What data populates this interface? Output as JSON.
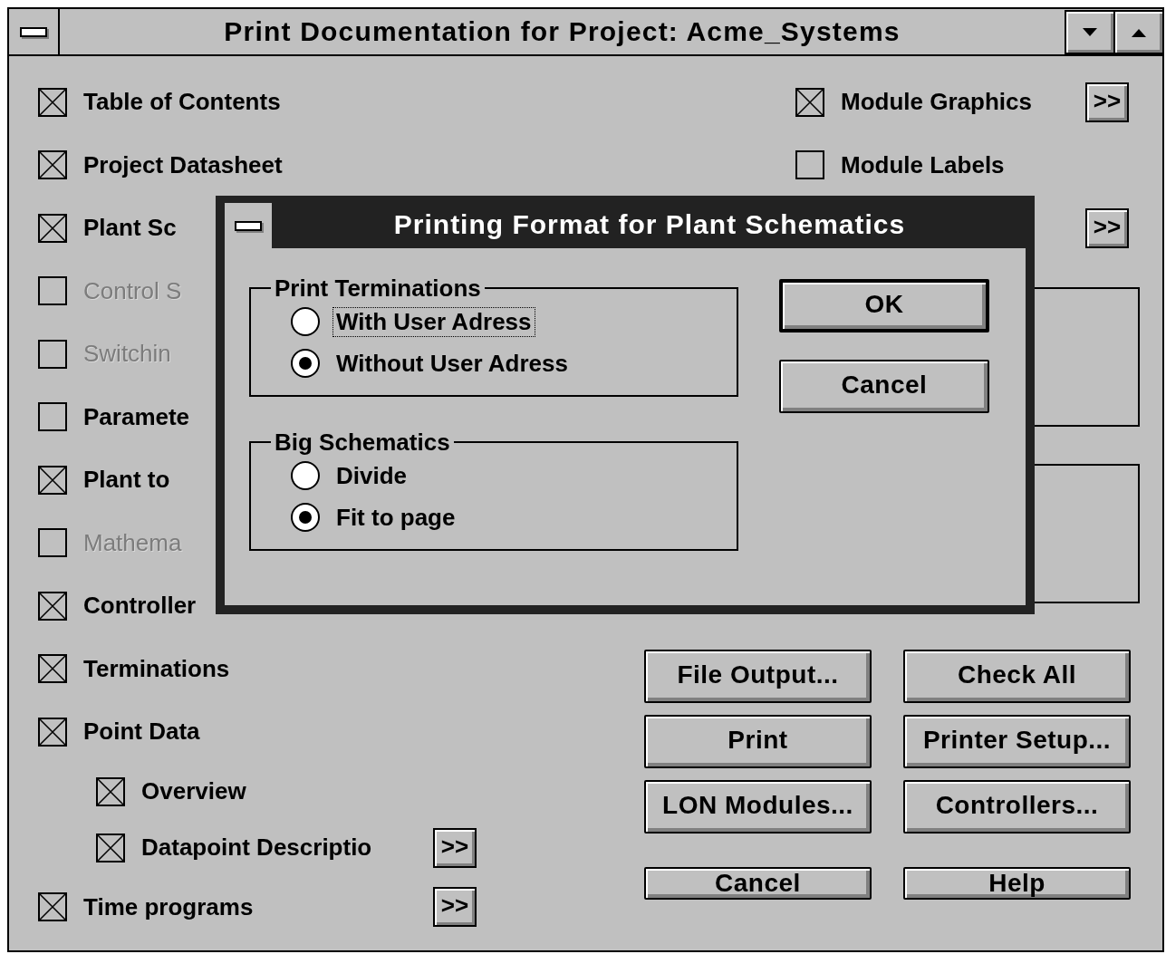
{
  "window": {
    "title": "Print Documentation for Project: Acme_Systems"
  },
  "left_options": [
    {
      "label": "Table of Contents",
      "checked": true,
      "disabled": false
    },
    {
      "label": "Project Datasheet",
      "checked": true,
      "disabled": false
    },
    {
      "label": "Plant Sc",
      "checked": true,
      "disabled": false
    },
    {
      "label": "Control S",
      "checked": false,
      "disabled": true
    },
    {
      "label": "Switchin",
      "checked": false,
      "disabled": true
    },
    {
      "label": "Paramete",
      "checked": false,
      "disabled": false
    },
    {
      "label": "Plant to",
      "checked": true,
      "disabled": false
    },
    {
      "label": "Mathema",
      "checked": false,
      "disabled": true
    },
    {
      "label": "Controller",
      "checked": true,
      "disabled": false
    },
    {
      "label": "Terminations",
      "checked": true,
      "disabled": false
    },
    {
      "label": "Point Data",
      "checked": true,
      "disabled": false,
      "children": [
        {
          "label": "Overview",
          "checked": true,
          "disabled": false
        },
        {
          "label": "Datapoint Descriptio",
          "checked": true,
          "disabled": false,
          "more_button": ">>"
        }
      ]
    },
    {
      "label": "Time programs",
      "checked": true,
      "disabled": false,
      "more_button": ">>"
    }
  ],
  "right_options": [
    {
      "kind": "checkbox",
      "label": "Module Graphics",
      "checked": true,
      "more_button": ">>"
    },
    {
      "kind": "checkbox",
      "label": "Module Labels",
      "checked": false
    },
    {
      "kind": "button_only",
      "more_button": ">>"
    }
  ],
  "buttons": [
    "File Output...",
    "Check All",
    "Print",
    "Printer Setup...",
    "LON Modules...",
    "Controllers...",
    "Cancel",
    "Help"
  ],
  "dialog": {
    "title": "Printing Format for Plant Schematics",
    "groups": [
      {
        "title": "Print Terminations",
        "options": [
          {
            "label": "With User Adress",
            "selected": false,
            "focused": true
          },
          {
            "label": "Without User Adress",
            "selected": true,
            "focused": false
          }
        ]
      },
      {
        "title": "Big Schematics",
        "options": [
          {
            "label": "Divide",
            "selected": false,
            "focused": false
          },
          {
            "label": "Fit to page",
            "selected": true,
            "focused": false
          }
        ]
      }
    ],
    "buttons": [
      {
        "label": "OK",
        "default": true
      },
      {
        "label": "Cancel",
        "default": false
      }
    ]
  }
}
